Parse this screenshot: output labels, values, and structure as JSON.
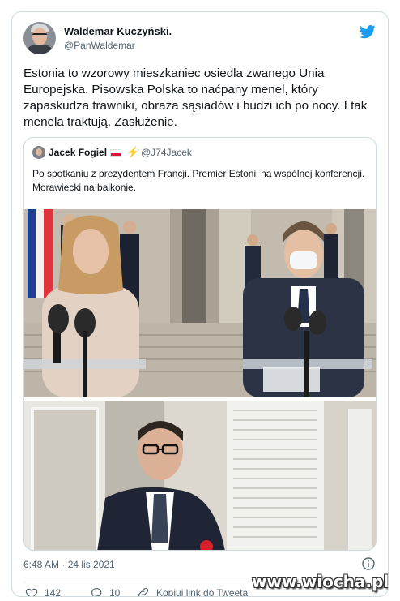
{
  "tweet": {
    "author_name": "Waldemar Kuczyński.",
    "author_handle": "@PanWaldemar",
    "text": "Estonia to wzorowy mieszkaniec osiedla zwanego Unia Europejska. Pisowska Polska to naćpany menel, który zapaskudza trawniki, obraża sąsiadów i budzi ich po nocy. I tak menela traktują. Zasłużenie.",
    "timestamp": "6:48 AM · 24 lis 2021"
  },
  "quoted": {
    "author_name": "Jacek Fogiel",
    "author_handle": "@J74Jacek",
    "text": "Po spotkaniu z prezydentem Francji. Premier Estonii na wspólnej konferencji. Morawiecki na balkonie."
  },
  "actions": {
    "likes": "142",
    "replies": "10",
    "copy_link": "Kopiuj link do Tweeta"
  },
  "watermark": "www.wiocha.pl",
  "colors": {
    "twitter_blue": "#1d9bf0",
    "text": "#0f1419",
    "muted": "#536471",
    "border": "#cfd9de"
  },
  "icons": [
    "twitter-bird-icon",
    "info-icon",
    "heart-icon",
    "reply-icon",
    "link-icon",
    "lightning-icon"
  ]
}
